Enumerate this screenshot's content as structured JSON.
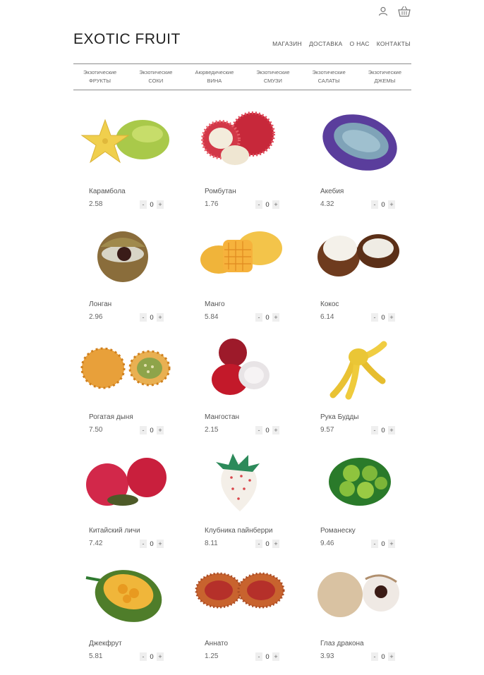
{
  "header": {
    "brand": "EXOTIC FRUIT",
    "nav": [
      "МАГАЗИН",
      "ДОСТАВКА",
      "О НАС",
      "КОНТАКТЫ"
    ],
    "icons": [
      "user-icon",
      "basket-icon"
    ]
  },
  "categories": [
    {
      "line1": "Экзотические",
      "line2": "ФРУКТЫ"
    },
    {
      "line1": "Экзотические",
      "line2": "СОКИ"
    },
    {
      "line1": "Аюрведические",
      "line2": "ВИНА"
    },
    {
      "line1": "Экзотические",
      "line2": "СМУЗИ"
    },
    {
      "line1": "Экзотические",
      "line2": "САЛАТЫ"
    },
    {
      "line1": "Экзотические",
      "line2": "ДЖЕМЫ"
    }
  ],
  "stepper": {
    "minus": "-",
    "plus": "+"
  },
  "products": [
    {
      "name": "Карамбола",
      "price": "2.58",
      "qty": "0"
    },
    {
      "name": "Ромбутан",
      "price": "1.76",
      "qty": "0"
    },
    {
      "name": "Акебия",
      "price": "4.32",
      "qty": "0"
    },
    {
      "name": "Лонган",
      "price": "2.96",
      "qty": "0"
    },
    {
      "name": "Манго",
      "price": "5.84",
      "qty": "0"
    },
    {
      "name": "Кокос",
      "price": "6.14",
      "qty": "0"
    },
    {
      "name": "Рогатая дыня",
      "price": "7.50",
      "qty": "0"
    },
    {
      "name": "Мангостан",
      "price": "2.15",
      "qty": "0"
    },
    {
      "name": "Рука Будды",
      "price": "9.57",
      "qty": "0"
    },
    {
      "name": "Китайский личи",
      "price": "7.42",
      "qty": "0"
    },
    {
      "name": "Клубника пайнберри",
      "price": "8.11",
      "qty": "0"
    },
    {
      "name": "Романеску",
      "price": "9.46",
      "qty": "0"
    },
    {
      "name": "Джекфрут",
      "price": "5.81",
      "qty": "0"
    },
    {
      "name": "Аннато",
      "price": "1.25",
      "qty": "0"
    },
    {
      "name": "Глаз дракона",
      "price": "3.93",
      "qty": "0"
    }
  ]
}
